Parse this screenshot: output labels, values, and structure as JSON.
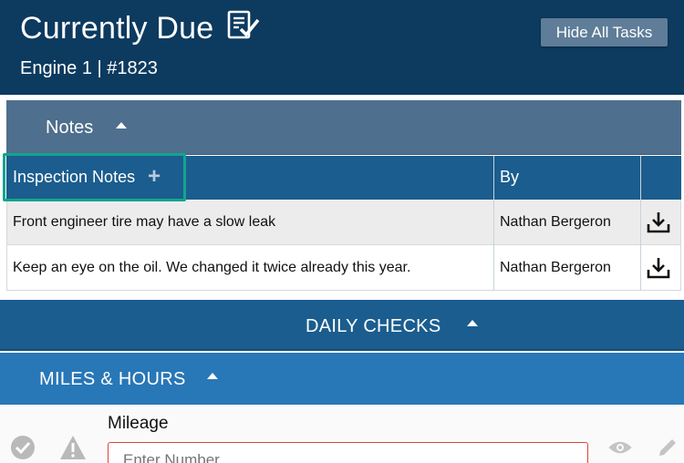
{
  "header": {
    "title": "Currently Due",
    "subtitle": "Engine 1 | #1823",
    "hide_tasks_label": "Hide All Tasks"
  },
  "notes_section": {
    "label": "Notes"
  },
  "notes_table": {
    "columns": [
      "Inspection Notes",
      "By",
      ""
    ],
    "rows": [
      {
        "note": "Front engineer tire may have a slow leak",
        "by": "Nathan Bergeron"
      },
      {
        "note": "Keep an eye on the oil. We changed it twice already this year.",
        "by": "Nathan Bergeron"
      }
    ]
  },
  "daily_checks": {
    "label": "DAILY CHECKS"
  },
  "miles_hours": {
    "label": "MILES & HOURS"
  },
  "mileage_item": {
    "label": "Mileage",
    "placeholder": "Enter Number"
  },
  "icons": {
    "title": "checklist-icon",
    "add": "plus-icon",
    "download": "download-icon",
    "check": "check-circle-icon",
    "warning": "warning-icon",
    "view": "eye-icon",
    "edit": "pencil-icon"
  },
  "colors": {
    "header_bg": "#0d3a5f",
    "notes_bar_bg": "#4e6f8d",
    "table_header_bg": "#1b5d8e",
    "miles_bg": "#2877b7",
    "highlight": "#12a58e",
    "input_border": "#d9463d"
  }
}
